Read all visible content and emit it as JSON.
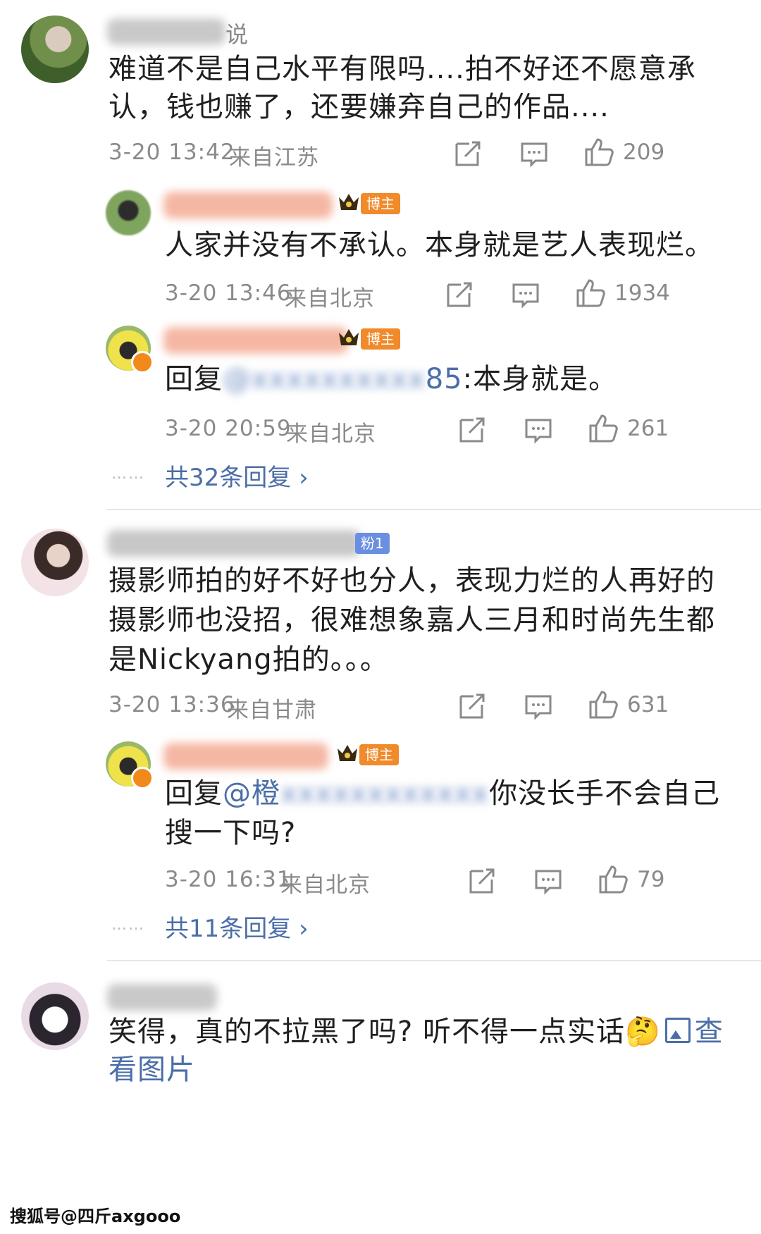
{
  "comments": [
    {
      "name_suffix": "说",
      "text_line1": "难道不是自己水平有限吗....拍不好还不愿意承",
      "text_line2": "认，钱也赚了，还要嫌弃自己的作品....",
      "time": "3-20 13:42",
      "location": "来自江苏",
      "likes": "209",
      "replies": [
        {
          "badge": "博主",
          "text": "人家并没有不承认。本身就是艺人表现烂。",
          "time": "3-20 13:46",
          "location": "来自北京",
          "likes": "1934"
        },
        {
          "badge": "博主",
          "prefix": "回复",
          "mention_tail": "85",
          "suffix": ":本身就是。",
          "time": "3-20 20:59",
          "location": "来自北京",
          "likes": "261"
        }
      ],
      "more_dots": "……",
      "more": "共32条回复 ›"
    },
    {
      "fan_badge": "粉1",
      "text_line1": "摄影师拍的好不好也分人，表现力烂的人再好的",
      "text_line2": "摄影师也没招，很难想象嘉人三月和时尚先生都",
      "text_line3": "是Nickyang拍的。。。",
      "time": "3-20 13:36",
      "location": "来自甘肃",
      "likes": "631",
      "replies": [
        {
          "badge": "博主",
          "prefix": "回复",
          "mention_head": "@橙",
          "suffix": "你没长手不会自己",
          "line2": "搜一下吗?",
          "time": "3-20 16:31",
          "location": "来自北京",
          "likes": "79"
        }
      ],
      "more_dots": "……",
      "more": "共11条回复 ›"
    },
    {
      "text_line1": "笑得，真的不拉黑了吗? 听不得一点实话",
      "emoji": "🤔",
      "view_image": "查",
      "text_line2": "看图片"
    }
  ],
  "watermark": "搜狐号@四斤axgooo",
  "colors": {
    "link": "#4b6ea8",
    "badge": "#f08a2a",
    "meta": "#8a8a8a"
  }
}
